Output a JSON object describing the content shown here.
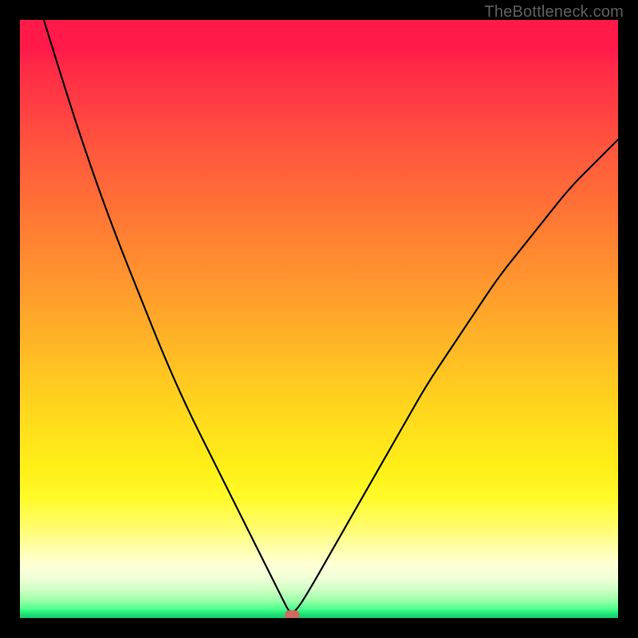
{
  "watermark": "TheBottleneck.com",
  "chart_data": {
    "type": "line",
    "title": "",
    "xlabel": "",
    "ylabel": "",
    "xlim": [
      0,
      100
    ],
    "ylim": [
      0,
      100
    ],
    "grid": false,
    "legend": false,
    "background_gradient": {
      "direction": "vertical",
      "stops": [
        {
          "pos": 0,
          "color": "#ff1a4a"
        },
        {
          "pos": 8,
          "color": "#ff2b47"
        },
        {
          "pos": 22,
          "color": "#ff583d"
        },
        {
          "pos": 37,
          "color": "#ff8332"
        },
        {
          "pos": 53,
          "color": "#ffb227"
        },
        {
          "pos": 68,
          "color": "#ffde1c"
        },
        {
          "pos": 80,
          "color": "#fffb2a"
        },
        {
          "pos": 91,
          "color": "#ffffd4"
        },
        {
          "pos": 97,
          "color": "#9effaa"
        },
        {
          "pos": 100,
          "color": "#14c867"
        }
      ]
    },
    "series": [
      {
        "name": "bottleneck-curve",
        "x": [
          4,
          8,
          12,
          16,
          20,
          24,
          28,
          32,
          36,
          40,
          42,
          44,
          45,
          46,
          48,
          52,
          56,
          60,
          64,
          68,
          72,
          76,
          80,
          84,
          88,
          92,
          96,
          100
        ],
        "y": [
          100,
          87,
          75,
          64,
          54,
          44,
          35,
          27,
          19,
          11,
          7,
          3,
          1,
          1,
          4,
          11,
          18,
          25,
          32,
          39,
          45,
          51,
          57,
          62,
          67,
          72,
          76,
          80
        ]
      }
    ],
    "marker": {
      "name": "optimal-point",
      "x": 45.5,
      "y": 0.5,
      "color": "#cf6a62",
      "shape": "rounded-rect"
    }
  }
}
